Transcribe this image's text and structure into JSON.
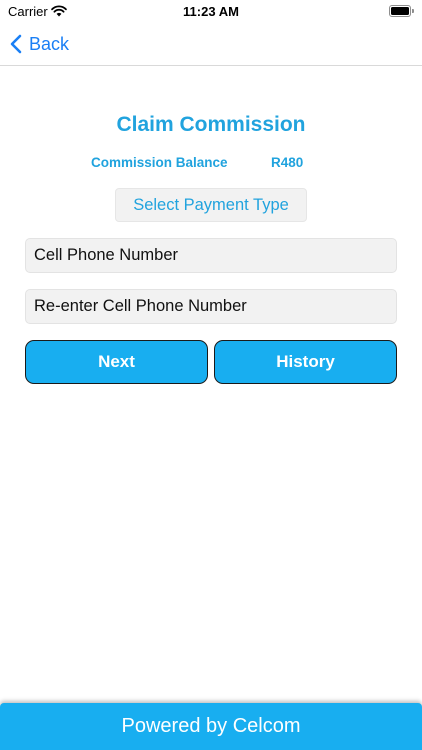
{
  "status_bar": {
    "carrier": "Carrier",
    "time": "11:23 AM",
    "wifi_icon": "wifi-icon",
    "battery_icon": "battery-icon"
  },
  "nav": {
    "back_label": "Back",
    "back_icon": "chevron-left-icon"
  },
  "main": {
    "title": "Claim Commission",
    "balance_label": "Commission Balance",
    "balance_value": "R480",
    "payment_type_label": "Select Payment Type",
    "cell_field_placeholder": "Cell Phone Number",
    "reenter_field_placeholder": "Re-enter Cell Phone Number",
    "next_label": "Next",
    "history_label": "History"
  },
  "footer": {
    "text": "Powered by Celcom"
  },
  "colors": {
    "accent": "#21a3de",
    "button": "#18aef0",
    "link": "#1a7ff5",
    "field_bg": "#f2f2f2"
  }
}
